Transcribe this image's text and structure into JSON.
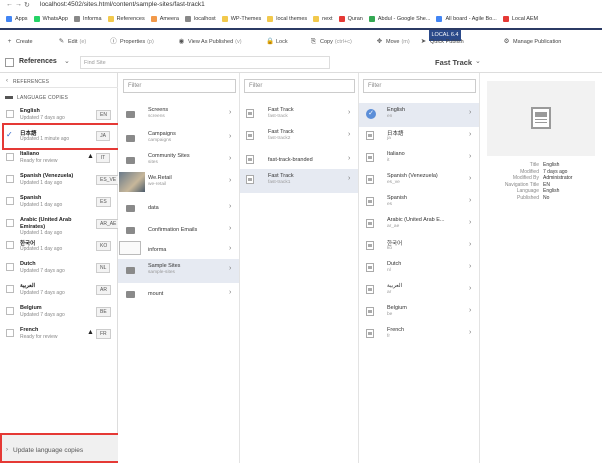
{
  "browser": {
    "url": "localhost:4502/sites.html/content/sample-sites/fast-track1",
    "bookmarks": [
      {
        "label": "Apps",
        "color": "#4285f4"
      },
      {
        "label": "WhatsApp",
        "color": "#25d366"
      },
      {
        "label": "Informa",
        "color": "#888888"
      },
      {
        "label": "References",
        "color": "#f2c94c"
      },
      {
        "label": "Ameera",
        "color": "#f2994a"
      },
      {
        "label": "localhost",
        "color": "#888888"
      },
      {
        "label": "WP-Themes",
        "color": "#f2c94c"
      },
      {
        "label": "local themes",
        "color": "#f2c94c"
      },
      {
        "label": "next",
        "color": "#f2c94c"
      },
      {
        "label": "Quran",
        "color": "#e53935"
      },
      {
        "label": "Abdul - Google She...",
        "color": "#34a853"
      },
      {
        "label": "All board - Agile Bo...",
        "color": "#4285f4"
      },
      {
        "label": "Local AEM",
        "color": "#e53935"
      }
    ]
  },
  "badge": "LOCAL 6.4",
  "actions": [
    {
      "label": "Create",
      "hint": "",
      "icon": "+"
    },
    {
      "label": "Edit",
      "hint": "(e)",
      "icon": "✎"
    },
    {
      "label": "Properties",
      "hint": "(p)",
      "icon": "ⓘ"
    },
    {
      "label": "View As Published",
      "hint": "(v)",
      "icon": "◉"
    },
    {
      "label": "Lock",
      "hint": "",
      "icon": "🔒"
    },
    {
      "label": "Copy",
      "hint": "(ctrl+c)",
      "icon": "⎘"
    },
    {
      "label": "Move",
      "hint": "(m)",
      "icon": "✥"
    },
    {
      "label": "Quick Publish",
      "hint": "",
      "icon": "➤"
    },
    {
      "label": "Manage Publication",
      "hint": "",
      "icon": "⚙"
    }
  ],
  "header": {
    "rail_label": "References",
    "search_placeholder": "Find Site",
    "title": "Fast Track"
  },
  "rail": {
    "back_label": "REFERENCES",
    "section_label": "LANGUAGE COPIES",
    "items": [
      {
        "title": "English",
        "sub": "Updated 7 days ago",
        "code": "EN",
        "warn": false,
        "checked": false
      },
      {
        "title": "日本語",
        "sub": "Updated 1 minute ago",
        "code": "JA",
        "warn": false,
        "checked": true
      },
      {
        "title": "Italiano",
        "sub": "Ready for review",
        "code": "IT",
        "warn": true,
        "checked": false
      },
      {
        "title": "Spanish (Venezuela)",
        "sub": "Updated 1 day ago",
        "code": "ES_VE",
        "warn": false,
        "checked": false
      },
      {
        "title": "Spanish",
        "sub": "Updated 1 day ago",
        "code": "ES",
        "warn": false,
        "checked": false
      },
      {
        "title": "Arabic (United Arab Emirates)",
        "sub": "Updated 1 day ago",
        "code": "AR_AE",
        "warn": false,
        "checked": false
      },
      {
        "title": "한국어",
        "sub": "Updated 1 day ago",
        "code": "KO",
        "warn": false,
        "checked": false
      },
      {
        "title": "Dutch",
        "sub": "Updated 7 days ago",
        "code": "NL",
        "warn": false,
        "checked": false
      },
      {
        "title": "العربية",
        "sub": "Updated 7 days ago",
        "code": "AR",
        "warn": false,
        "checked": false
      },
      {
        "title": "Belgium",
        "sub": "Updated 7 days ago",
        "code": "BE",
        "warn": false,
        "checked": false
      },
      {
        "title": "French",
        "sub": "Ready for review",
        "code": "FR",
        "warn": true,
        "checked": false
      }
    ],
    "update_label": "Update language copies"
  },
  "columns": {
    "filter_placeholder": "Filter",
    "col1": [
      {
        "title": "Screens",
        "sub": "screens",
        "icon": "folder"
      },
      {
        "title": "Campaigns",
        "sub": "campaigns",
        "icon": "folder"
      },
      {
        "title": "Community Sites",
        "sub": "sites",
        "icon": "folder"
      },
      {
        "title": "We.Retail",
        "sub": "we-retail",
        "icon": "photo"
      },
      {
        "title": "data",
        "sub": "",
        "icon": "folder"
      },
      {
        "title": "Confirmation Emails",
        "sub": "",
        "icon": "folder"
      },
      {
        "title": "informa",
        "sub": "",
        "icon": "broken"
      },
      {
        "title": "Sample Sites",
        "sub": "sample-sites",
        "icon": "folder"
      },
      {
        "title": "mount",
        "sub": "",
        "icon": "folder"
      }
    ],
    "col2": [
      {
        "title": "Fast Track",
        "sub": "fast-track"
      },
      {
        "title": "Fast Track",
        "sub": "fast-track2"
      },
      {
        "title": "fast-track-branded",
        "sub": ""
      },
      {
        "title": "Fast Track",
        "sub": "fast-track1"
      }
    ],
    "col3": [
      {
        "title": "English",
        "sub": "en"
      },
      {
        "title": "日本語",
        "sub": "ja"
      },
      {
        "title": "Italiano",
        "sub": "it"
      },
      {
        "title": "Spanish (Venezuela)",
        "sub": "es_ve"
      },
      {
        "title": "Spanish",
        "sub": "es"
      },
      {
        "title": "Arabic (United Arab E...",
        "sub": "ar_ae"
      },
      {
        "title": "한국어",
        "sub": "ko"
      },
      {
        "title": "Dutch",
        "sub": "nl"
      },
      {
        "title": "العربية",
        "sub": "ar"
      },
      {
        "title": "Belgium",
        "sub": "be"
      },
      {
        "title": "French",
        "sub": "fr"
      }
    ]
  },
  "properties": [
    {
      "key": "Title",
      "value": "English"
    },
    {
      "key": "Modified",
      "value": "7 days ago"
    },
    {
      "key": "Modified By",
      "value": "Administrator"
    },
    {
      "key": "Navigation Title",
      "value": "EN"
    },
    {
      "key": "Language",
      "value": "English"
    },
    {
      "key": "Published",
      "value": "No"
    }
  ],
  "colors": {
    "accent": "#2b3a64",
    "selected_row": "#e6eaf2",
    "highlight_box": "#e53935"
  }
}
